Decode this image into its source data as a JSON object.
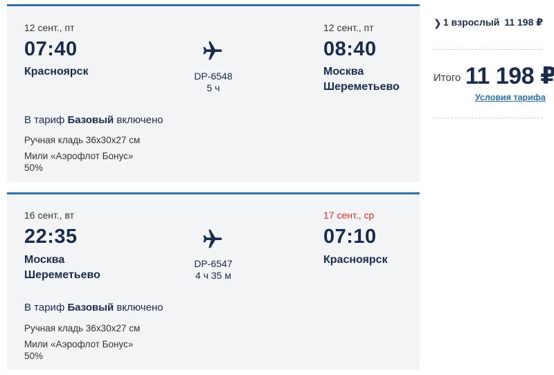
{
  "flights": [
    {
      "dep_date": "12 сент., пт",
      "dep_time": "07:40",
      "dep_city": [
        "Красноярск"
      ],
      "flight_no": "DP-6548",
      "duration": "5 ч",
      "arr_date": "12 сент., пт",
      "arr_date_color": "#333333",
      "arr_time": "08:40",
      "arr_city": [
        "Москва",
        "Шереметьево"
      ],
      "fare_prefix": "В тариф ",
      "fare_name": "Базовый",
      "fare_suffix": " включено",
      "baggage": "Ручная кладь 36x30x27 см",
      "miles_line1": "Мили «Аэрофлот Бонус»",
      "miles_line2": "50%"
    },
    {
      "dep_date": "16 сент., вт",
      "dep_time": "22:35",
      "dep_city": [
        "Москва",
        "Шереметьево"
      ],
      "flight_no": "DP-6547",
      "duration": "4 ч 35 м",
      "arr_date": "17 сент., ср",
      "arr_date_color": "#d2322d",
      "arr_time": "07:10",
      "arr_city": [
        "Красноярск"
      ],
      "fare_prefix": "В тариф ",
      "fare_name": "Базовый",
      "fare_suffix": " включено",
      "baggage": "Ручная кладь 36x30x27 см",
      "miles_line1": "Мили «Аэрофлот Бонус»",
      "miles_line2": "50%"
    }
  ],
  "sidebar": {
    "chevron_icon": "chevron-right-icon",
    "passengers": "1 взрослый",
    "passengers_price": "11 198 ₽",
    "total_label": "Итого",
    "total_value": "11 198 ₽",
    "tariff_link": "Условия тарифа"
  },
  "colors": {
    "accent": "#2f6fa3",
    "text_dark": "#1a2b4c",
    "card_bg": "#f2f4f6",
    "red_date": "#d2322d"
  },
  "icons": [
    "airplane-icon",
    "chevron-right-icon"
  ]
}
